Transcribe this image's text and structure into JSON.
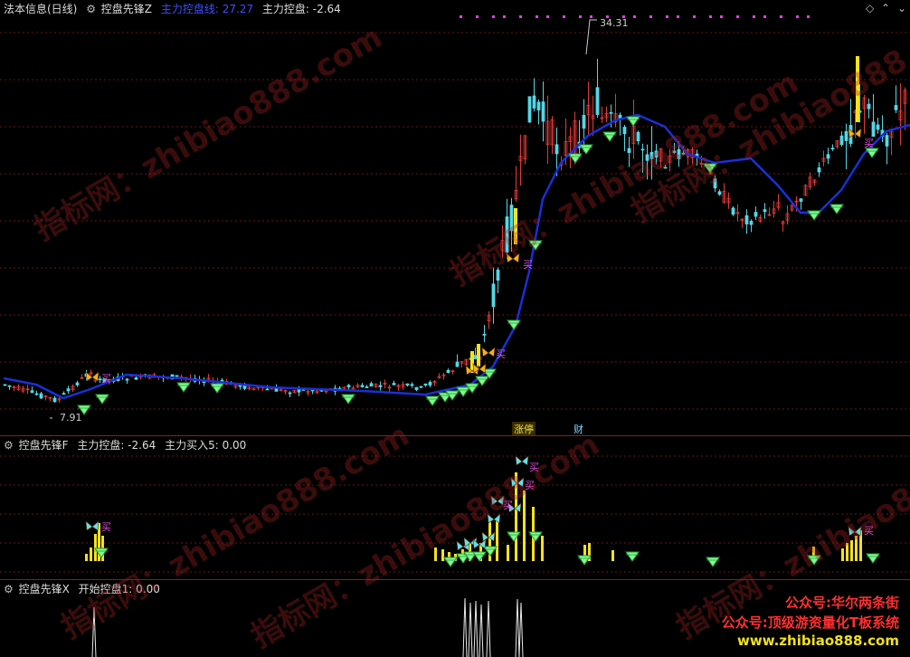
{
  "main_pane": {
    "title": "法本信息(日线)",
    "indicator": "控盘先锋Z",
    "line_label": "主力控盘线: 27.27",
    "value_label": "主力控盘: -2.64",
    "high_label": "34.31",
    "low_label": "7.91",
    "buy_label": "买",
    "marker_a": "涨停",
    "marker_b": "财",
    "corner_icons": [
      "diamond-icon",
      "up-arrow-icon",
      "down-arrow-icon"
    ]
  },
  "sub_pane_f": {
    "indicator": "控盘先锋F",
    "value_label": "主力控盘: -2.64",
    "buy_value": "主力买入5: 0.00",
    "buy_label": "买"
  },
  "sub_pane_x": {
    "indicator": "控盘先锋X",
    "value_label": "开始控盘1: 0.00"
  },
  "watermarks": [
    "指标网：zhibiao888.com",
    "指标网：zhibiao888.com",
    "指标网：zhibiao888.com",
    "指标网：zhibiao888.com",
    "指标网：zhibiao888.com",
    "指标网：zhibiao888.com"
  ],
  "promo": {
    "line1": "公众号:华尔两条街",
    "line2": "公众号:顶级游资量化T板系统",
    "line3": "www.zhibiao888.com"
  },
  "colors": {
    "up": "#e03a3a",
    "down": "#54d7e6",
    "control_line": "#1a2fd8",
    "buy_yellow": "#f4e21c",
    "diamond_green": "#7dff8e",
    "grid": "#6a1515"
  },
  "chart_data": {
    "type": "candlestick",
    "price_high": 34.31,
    "price_low": 7.91,
    "control_line_last": 27.27
  }
}
